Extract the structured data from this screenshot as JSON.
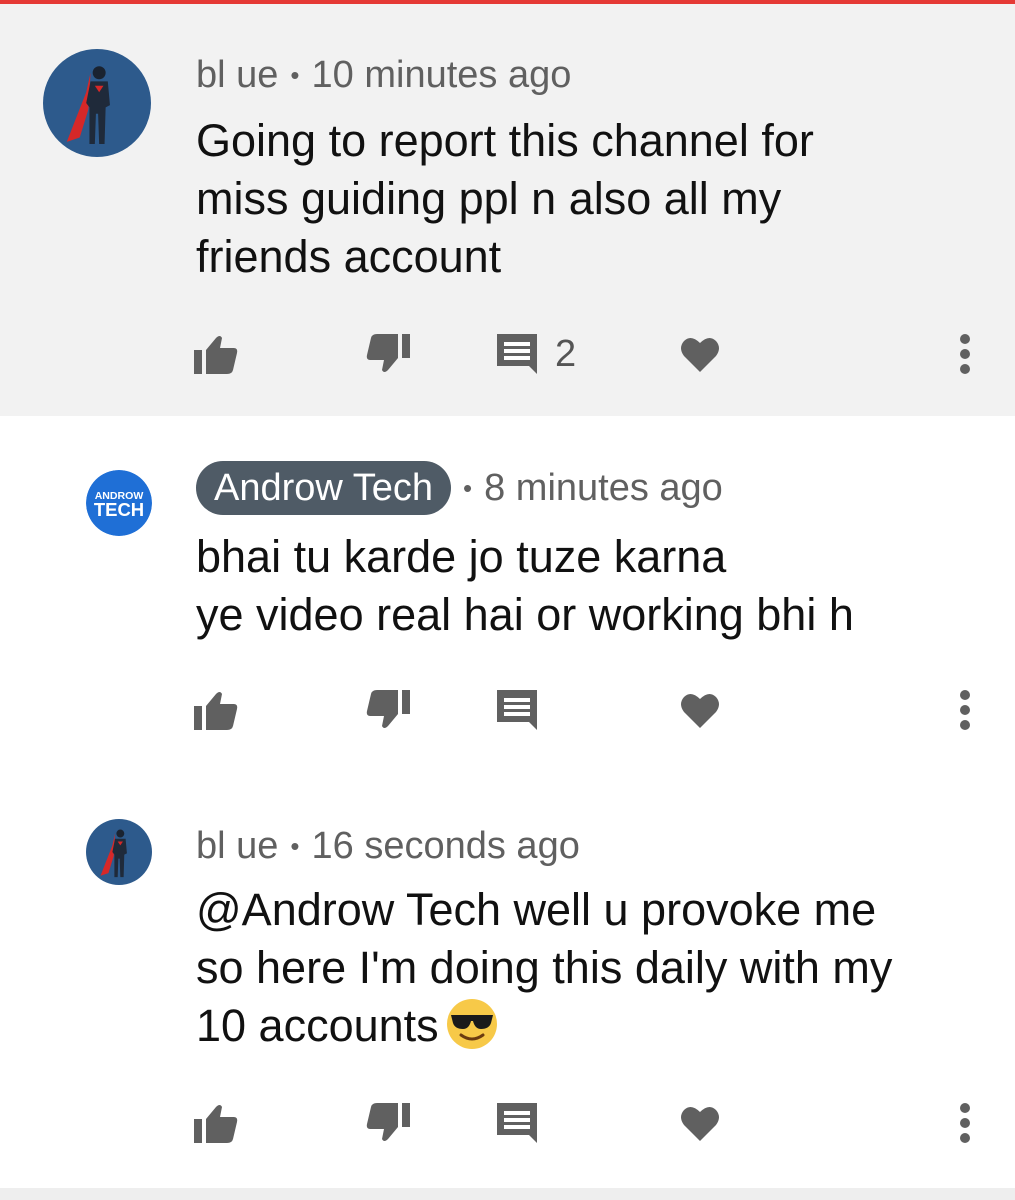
{
  "colors": {
    "accent_bar": "#e53935",
    "highlight_bg": "#f2f2f2",
    "owner_pill_bg": "#4f5b66",
    "icon": "#606060"
  },
  "comments": [
    {
      "author": "bl ue",
      "separator": "•",
      "time": "10 minutes ago",
      "text": "Going to report this channel for\nmiss guiding ppl n also all my\nfriends account",
      "reply_count": "2",
      "avatar": "superman-avatar-icon",
      "highlighted": true
    },
    {
      "author": "Androw Tech",
      "separator": "•",
      "time": "8 minutes ago",
      "text": "bhai tu karde jo tuze karna\nye video real hai or working bhi h",
      "avatar_label_top": "ANDROW",
      "avatar_label_bottom": "TECH",
      "is_channel_owner": true
    },
    {
      "author": "bl ue",
      "separator": "•",
      "time": "16 seconds ago",
      "text": "@Androw Tech well u provoke me\nso here I'm doing this daily with my\n10 accounts",
      "emoji": "smiling-face-with-sunglasses-icon",
      "avatar": "superman-avatar-icon"
    }
  ],
  "icons": {
    "like": "thumbs-up-icon",
    "dislike": "thumbs-down-icon",
    "reply": "reply-comment-icon",
    "heart": "heart-icon",
    "more": "more-vertical-icon"
  }
}
